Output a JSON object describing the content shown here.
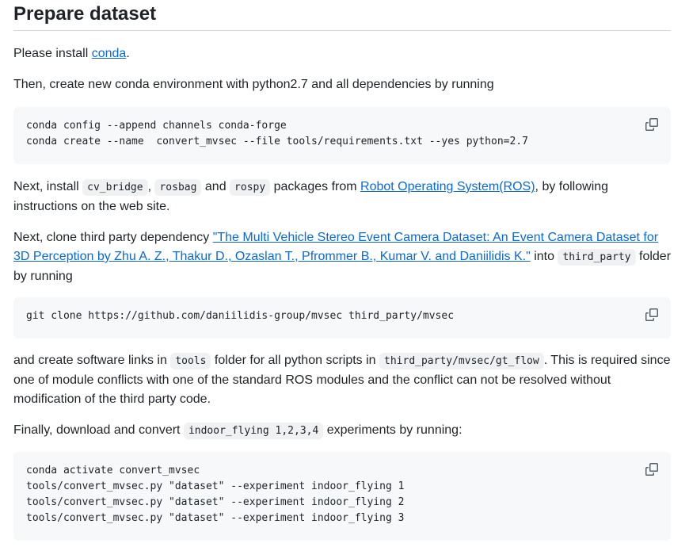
{
  "heading": "Prepare dataset",
  "p1": {
    "pre": "Please install ",
    "link": "conda",
    "post": "."
  },
  "p2": {
    "text": "Then, create new conda environment with python2.7 and all dependencies by running"
  },
  "code1": {
    "lines": [
      "conda config --append channels conda-forge",
      "conda create --name  convert_mvsec --file tools/requirements.txt --yes python=2.7"
    ]
  },
  "p3": {
    "t1": "Next, install ",
    "c1": "cv_bridge",
    "t2": ", ",
    "c2": "rosbag",
    "t3": " and ",
    "c3": "rospy",
    "t4": " packages from ",
    "link": "Robot Operating System(ROS)",
    "t5": ", by following instructions on the web site."
  },
  "p4": {
    "t1": "Next, clone third party dependency ",
    "link": "\"The Multi Vehicle Stereo Event Camera Dataset: An Event Camera Dataset for 3D Perception by Zhu A. Z., Thakur D., Ozaslan T., Pfrommer B., Kumar V. and Daniilidis K.\"",
    "t2": " into ",
    "c1": "third_party",
    "t3": " folder by running"
  },
  "code2": {
    "lines": [
      "git clone https://github.com/daniilidis-group/mvsec third_party/mvsec"
    ]
  },
  "p5": {
    "t1": "and create software links in ",
    "c1": "tools",
    "t2": " folder for all python scripts in ",
    "c2": "third_party/mvsec/gt_flow",
    "t3": ". This is required since one of module conflicts with one of the standard ROS modules and the conflict can not be resolved without modification of the third party code."
  },
  "p6": {
    "t1": "Finally, download and convert ",
    "c1": "indoor_flying 1,2,3,4",
    "t2": " experiments by running:"
  },
  "code3": {
    "lines": [
      "conda activate convert_mvsec",
      "tools/convert_mvsec.py \"dataset\" --experiment indoor_flying 1",
      "tools/convert_mvsec.py \"dataset\" --experiment indoor_flying 2",
      "tools/convert_mvsec.py \"dataset\" --experiment indoor_flying 3"
    ]
  },
  "icons": {
    "copy": "copy-icon"
  },
  "colors": {
    "link": "#0969da",
    "code_bg": "#f6f8fa",
    "inline_code_bg": "#eff1f3",
    "text": "#1f2328"
  }
}
